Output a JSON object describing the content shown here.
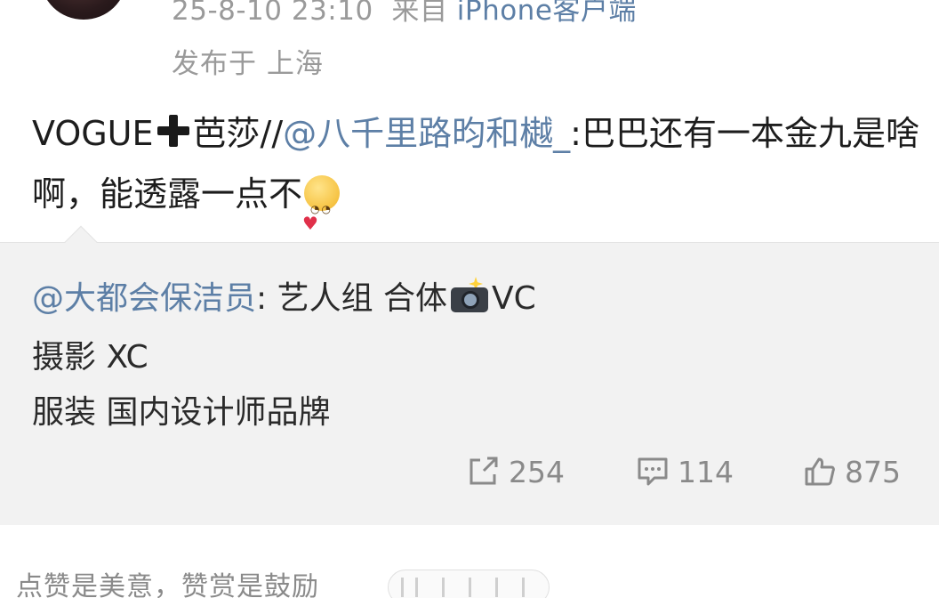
{
  "header": {
    "datetime": "25-8-10 23:10",
    "source_prefix": "来自",
    "client": "iPhone客户端",
    "location": "发布于 上海"
  },
  "post": {
    "text_before_plus": "VOGUE",
    "text_after_plus": "芭莎//",
    "mention": "@八千里路昀和樾_",
    "text_after_mention": ":巴巴还有一本金九是啥啊，能透露一点不"
  },
  "retweet": {
    "author": "@大都会保洁员",
    "line1_after_author": ": 艺人组 合体",
    "line1_end": "VC",
    "line2": "摄影 XC",
    "line3": "服装 国内设计师品牌"
  },
  "actions": {
    "repost_count": "254",
    "comment_count": "114",
    "like_count": "875"
  },
  "footer": {
    "reward_text": "点赞是美意，赞赏是鼓励"
  },
  "colors": {
    "link": "#5d7fa6",
    "meta_gray": "#9a9a9a",
    "retweet_bg": "#f2f2f2"
  }
}
